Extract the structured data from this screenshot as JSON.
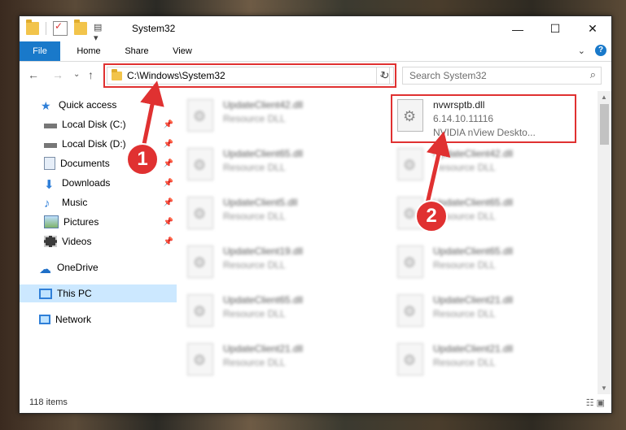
{
  "window": {
    "title": "System32"
  },
  "ribbon": {
    "tabs": [
      "File",
      "Home",
      "Share",
      "View"
    ]
  },
  "address": {
    "path": "C:\\Windows\\System32",
    "search_placeholder": "Search System32"
  },
  "nav": {
    "quick_access": "Quick access",
    "items": [
      "Local Disk (C:)",
      "Local Disk (D:)",
      "Documents",
      "Downloads",
      "Music",
      "Pictures",
      "Videos"
    ],
    "onedrive": "OneDrive",
    "this_pc": "This PC",
    "network": "Network"
  },
  "files": {
    "left": [
      {
        "name": "UpdateClient42.dll",
        "type": "Resource DLL"
      },
      {
        "name": "UpdateClient65.dll",
        "type": "Resource DLL"
      },
      {
        "name": "UpdateClient5.dll",
        "type": "Resource DLL"
      },
      {
        "name": "UpdateClient19.dll",
        "type": "Resource DLL"
      },
      {
        "name": "UpdateClient65.dll",
        "type": "Resource DLL"
      },
      {
        "name": "UpdateClient21.dll",
        "type": "Resource DLL"
      }
    ],
    "highlight": {
      "name": "nvwrsptb.dll",
      "version": "6.14.10.11116",
      "desc": "NVIDIA nView Deskto..."
    },
    "right": [
      {
        "name": "UpdateClient42.dll",
        "type": "Resource DLL"
      },
      {
        "name": "UpdateClient65.dll",
        "type": "Resource DLL"
      },
      {
        "name": "UpdateClient65.dll",
        "type": "Resource DLL"
      },
      {
        "name": "UpdateClient21.dll",
        "type": "Resource DLL"
      },
      {
        "name": "UpdateClient21.dll",
        "type": "Resource DLL"
      }
    ]
  },
  "status": {
    "count": "118 items"
  },
  "callouts": [
    "1",
    "2"
  ],
  "colors": {
    "accent": "#1979ca",
    "callout": "#e03131",
    "selection": "#cce8ff"
  }
}
